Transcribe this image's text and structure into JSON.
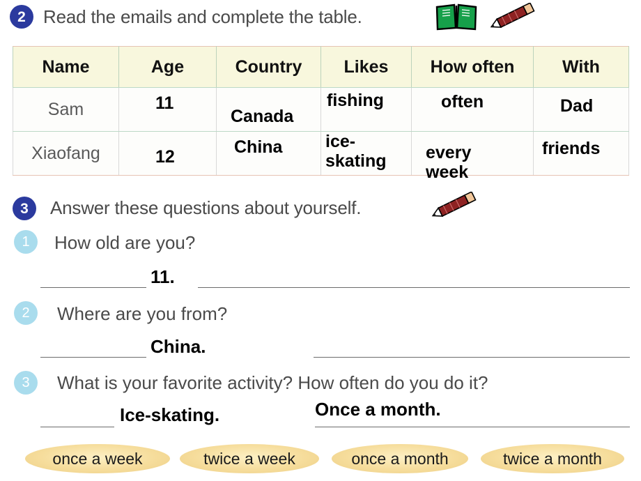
{
  "exercise2": {
    "number": "2",
    "instruction": "Read the emails and complete the table.",
    "icons": [
      "open-book-icon",
      "pencil-icon"
    ],
    "table": {
      "headers": [
        "Name",
        "Age",
        "Country",
        "Likes",
        "How often",
        "With"
      ],
      "rows": [
        {
          "name": "Sam",
          "age": "11",
          "country": "Canada",
          "likes": "fishing",
          "how_often": "often",
          "with": "Dad"
        },
        {
          "name": "Xiaofang",
          "age": "12",
          "country": "China",
          "likes": "ice-skating",
          "how_often": "every week",
          "with": "friends"
        }
      ]
    }
  },
  "exercise3": {
    "number": "3",
    "instruction": "Answer these questions about yourself.",
    "icons": [
      "pencil-icon"
    ],
    "questions": [
      {
        "number": "1",
        "text": "How old are you?",
        "answer": "11.",
        "answer2": ""
      },
      {
        "number": "2",
        "text": "Where are you from?",
        "answer": "China.",
        "answer2": ""
      },
      {
        "number": "3",
        "text": "What is your favorite activity? How often do you do it?",
        "answer": "Ice-skating.",
        "answer2": "Once a month."
      }
    ]
  },
  "word_bank": {
    "options": [
      "once a week",
      "twice a week",
      "once a month",
      "twice a month"
    ]
  },
  "colors": {
    "badge_main": "#2b3a9e",
    "badge_sub": "#a9dced",
    "table_header_bg": "#f8f7dd",
    "table_outer_border": "#e6c3b4",
    "pill_fill": "#f6dd9c",
    "book_green": "#16a04a",
    "pencil_red": "#8e2222"
  }
}
